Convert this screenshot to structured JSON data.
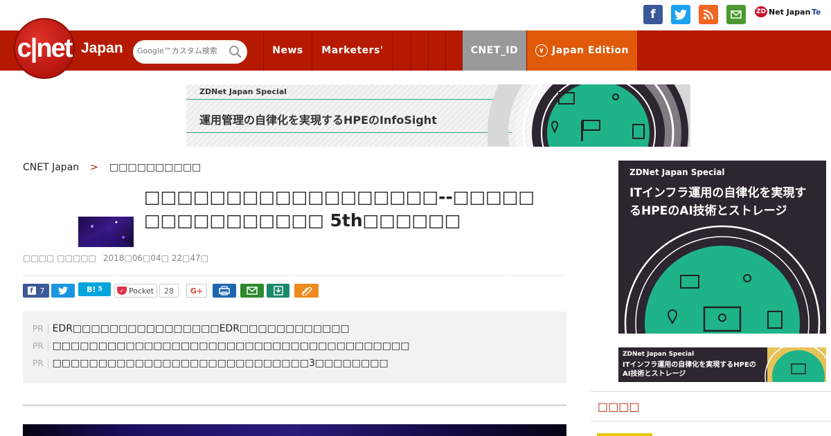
{
  "social": {
    "facebook": "f",
    "twitter": "t",
    "rss": "rss",
    "mail": "mail",
    "zdnet_badge": "ZD",
    "zdnet_label": "Net Japan",
    "te_label": "Te"
  },
  "header": {
    "logo_text": "c|net",
    "logo_japan": "Japan",
    "search_placeholder": "Google™カスタム検索",
    "nav": {
      "news": "News",
      "marketers": "Marketers'",
      "cnet_id": "CNET_ID",
      "japan_edition": "Japan Edition"
    }
  },
  "top_banner": {
    "label": "ZDNet Japan Special",
    "headline": "運用管理の自律化を実現するHPEのInfoSight"
  },
  "breadcrumb": {
    "home": "CNET Japan",
    "sep": ">",
    "current": "□□□□□□□□□□"
  },
  "article": {
    "title": "□□□□□□□□□□□□□□□□□□--□□□□□ □□□□□□□□□□□ 5th□□□□□□",
    "author": "□□□□ □□□□□",
    "date": "2018□06□04□ 22□47□"
  },
  "share": {
    "fb_count": "7",
    "hatena_label": "B!",
    "hatena_count": "5",
    "pocket_label": "Pocket",
    "pocket_count": "28",
    "gplus_label": "G+"
  },
  "pr": {
    "tag": "PR",
    "items": [
      "EDR□□□□□□□□□□□□□□□□EDR□□□□□□□□□□□□",
      "□□□□□□□□□□□□□□□□□□□□□□□□□□□□□□□□□□□□□□□",
      "□□□□□□□□□□□□□□□□□□□□□□□□□□□□3□□□□□□□□"
    ]
  },
  "side": {
    "ad_label": "ZDNet Japan Special",
    "ad_headline": "ITインフラ運用の自律化を実現するHPEのAI技術とストレージ",
    "ad2_label": "ZDNet Japan Special",
    "ad2_headline": "ITインフラ運用の自律化を実現するHPEのAI技術とストレージ",
    "section_title": "□□□□"
  },
  "colors": {
    "brand_red": "#b51a00",
    "accent_orange": "#e05a0a",
    "ad_green": "#2ca48a"
  }
}
